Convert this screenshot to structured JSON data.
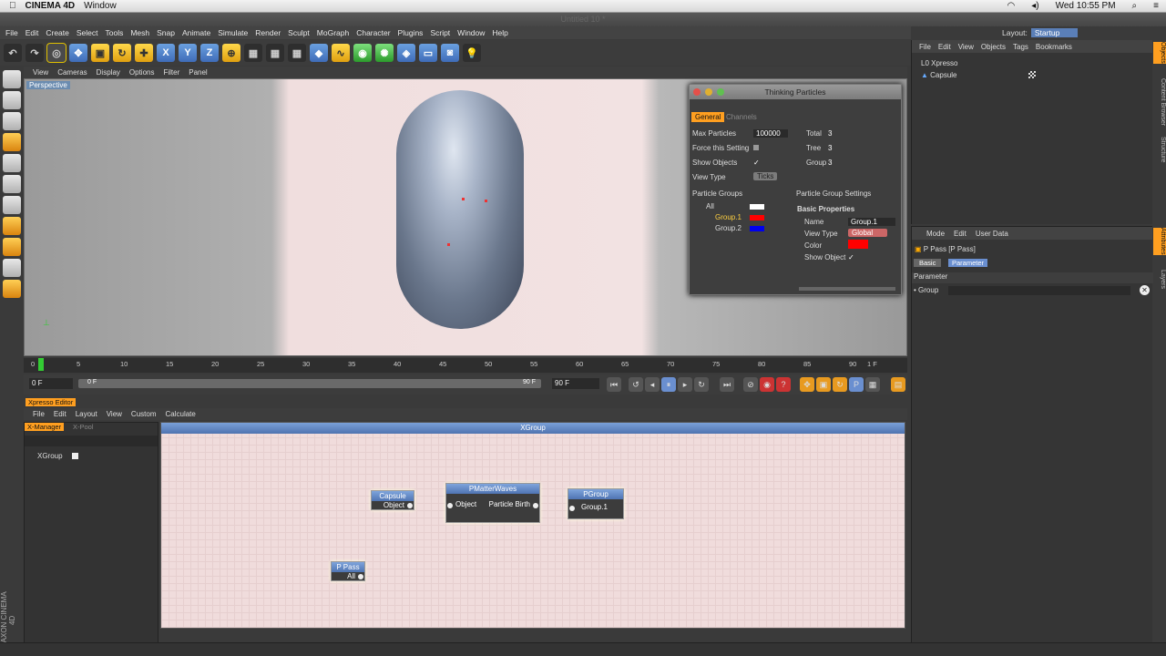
{
  "macbar": {
    "app": "CINEMA 4D",
    "menus": [
      "Window"
    ],
    "clock": "Wed 10:55 PM"
  },
  "window_title": "Untitled 10 *",
  "main_menu": [
    "File",
    "Edit",
    "Create",
    "Select",
    "Tools",
    "Mesh",
    "Snap",
    "Animate",
    "Simulate",
    "Render",
    "Sculpt",
    "MoGraph",
    "Character",
    "Plugins",
    "Script",
    "Window",
    "Help"
  ],
  "layout": {
    "label": "Layout:",
    "value": "Startup"
  },
  "viewport": {
    "menu": [
      "View",
      "Cameras",
      "Display",
      "Options",
      "Filter",
      "Panel"
    ],
    "label": "Perspective"
  },
  "thinking_particles": {
    "title": "Thinking Particles",
    "tabs": [
      "General",
      "Channels"
    ],
    "max_particles_label": "Max Particles",
    "max_particles_value": "100000",
    "force_setting_label": "Force this Setting",
    "show_objects_label": "Show Objects",
    "view_type_label": "View Type",
    "view_type_value": "Ticks",
    "total_label": "Total",
    "total_value": "3",
    "tree_label": "Tree",
    "tree_value": "3",
    "group_label": "Group",
    "group_value": "3",
    "particle_groups_label": "Particle Groups",
    "groups": [
      {
        "name": "All",
        "color": "#ffffff"
      },
      {
        "name": "Group.1",
        "color": "#ff0000"
      },
      {
        "name": "Group.2",
        "color": "#0000ee"
      }
    ],
    "settings_label": "Particle Group Settings",
    "basic_props_label": "Basic Properties",
    "name_label": "Name",
    "name_value": "Group.1",
    "pg_view_type_label": "View Type",
    "pg_view_type_value": "Global",
    "color_label": "Color",
    "color_value": "#ff0000",
    "show_object_label": "Show Object",
    "checkmark": "✓"
  },
  "object_manager": {
    "menu": [
      "File",
      "Edit",
      "View",
      "Objects",
      "Tags",
      "Bookmarks"
    ],
    "objects": [
      "Xpresso",
      "Capsule"
    ]
  },
  "attribute_manager": {
    "menu": [
      "Mode",
      "Edit",
      "User Data"
    ],
    "title": "P Pass [P Pass]",
    "tabs": [
      "Basic",
      "Parameter"
    ],
    "section": "Parameter",
    "param": "Group"
  },
  "right_tabs": [
    "Objects",
    "Content Browser",
    "Structure",
    "Attributes",
    "Layers"
  ],
  "timeline": {
    "ticks": [
      "0",
      "5",
      "10",
      "15",
      "20",
      "25",
      "30",
      "35",
      "40",
      "45",
      "50",
      "55",
      "60",
      "65",
      "70",
      "75",
      "80",
      "85",
      "90"
    ],
    "current_label": "1 F",
    "start_field": "0 F",
    "range_start": "0 F",
    "range_end": "90 F",
    "end_field": "90 F"
  },
  "xpresso": {
    "title": "Xpresso Editor",
    "menu": [
      "File",
      "Edit",
      "Layout",
      "View",
      "Custom",
      "Calculate"
    ],
    "pool_tabs": [
      "X-Manager",
      "X-Pool"
    ],
    "pool_item": "XGroup",
    "group_title": "XGroup",
    "nodes": {
      "capsule": {
        "title": "Capsule",
        "port": "Object"
      },
      "pmatter": {
        "title": "PMatterWaves",
        "in_port": "Object",
        "out_port": "Particle Birth"
      },
      "pgroup": {
        "title": "PGroup",
        "port": "Group.1"
      },
      "ppass": {
        "title": "P Pass",
        "port": "All"
      }
    }
  },
  "maxon": "MAXON CINEMA 4D"
}
